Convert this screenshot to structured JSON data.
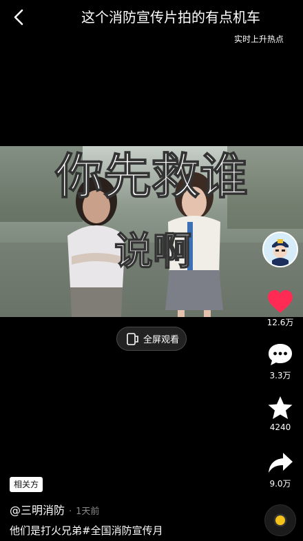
{
  "header": {
    "title": "这个消防宣传片拍的有点机车",
    "hot_label": "实时上升热点"
  },
  "video": {
    "caption_line1": "你先救谁",
    "caption_line2": "说啊",
    "fullscreen_label": "全屏观看"
  },
  "actions": {
    "like_count": "12.6万",
    "comment_count": "3.3万",
    "favorite_count": "4240",
    "share_count": "9.0万",
    "like_color": "#ff2b54"
  },
  "post": {
    "tag": "相关方",
    "author": "@三明消防",
    "separator": "·",
    "time": "1天前",
    "description": "他们是打火兄弟#全国消防宣传月"
  },
  "icons": [
    "back-icon",
    "fullscreen-icon",
    "heart-icon",
    "comment-icon",
    "star-icon",
    "share-icon",
    "music-disc-icon"
  ]
}
